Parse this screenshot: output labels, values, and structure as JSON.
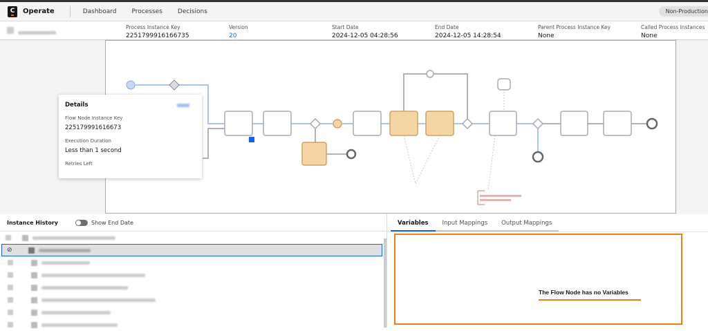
{
  "header": {
    "logo_letter": "C",
    "app_name": "Operate",
    "nav": [
      "Dashboard",
      "Processes",
      "Decisions"
    ],
    "environment_badge": "Non-Production"
  },
  "instance": {
    "columns": [
      {
        "label": "Process Instance Key",
        "value": "2251799916166735"
      },
      {
        "label": "Version",
        "value": "20"
      },
      {
        "label": "Start Date",
        "value": "2024-12-05 04:28:56"
      },
      {
        "label": "End Date",
        "value": "2024-12-05 14:28:54"
      },
      {
        "label": "Parent Process Instance Key",
        "value": "None"
      },
      {
        "label": "Called Process Instances",
        "value": "None"
      }
    ]
  },
  "details_popup": {
    "title": "Details",
    "flow_node_key_label": "Flow Node Instance Key",
    "flow_node_key_value": "225179991616673",
    "duration_label": "Execution Duration",
    "duration_value": "Less than 1 second",
    "retries_label": "Retries Left"
  },
  "history": {
    "title": "Instance History",
    "toggle_label": "Show End Date",
    "toggle_on": false
  },
  "variables": {
    "tabs": [
      "Variables",
      "Input Mappings",
      "Output Mappings"
    ],
    "active_tab": "Variables",
    "empty_message": "The Flow Node has no Variables"
  },
  "colors": {
    "accent": "#0f62fe",
    "highlight": "#f77c16",
    "active_task": "#f5d5a3"
  }
}
